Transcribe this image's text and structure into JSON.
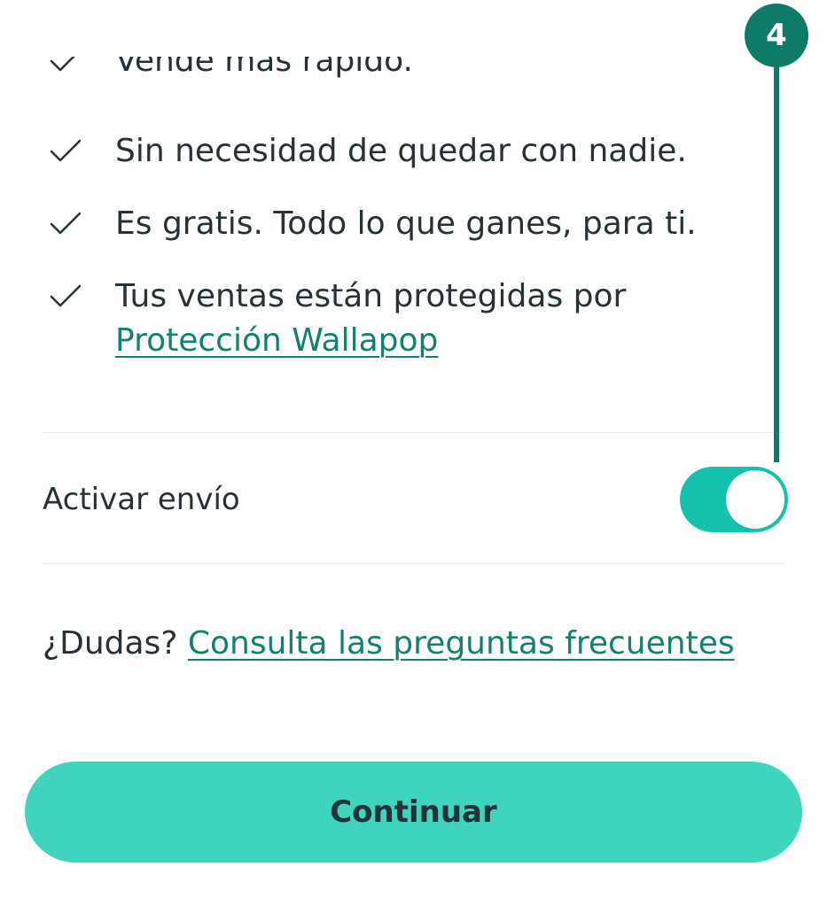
{
  "benefits": {
    "items": [
      {
        "text": "Vende más rápido."
      },
      {
        "text": "Sin necesidad de quedar con nadie."
      },
      {
        "text": "Es gratis. Todo lo que ganes, para ti."
      },
      {
        "text": "Tus ventas están protegidas por",
        "link": "Protección Wallapop"
      }
    ]
  },
  "shipping_toggle": {
    "label": "Activar envío",
    "on": true
  },
  "faq": {
    "prefix": "¿Dudas?",
    "link": "Consulta las preguntas frecuentes"
  },
  "cta": {
    "label": "Continuar"
  },
  "annotation": {
    "number": "4"
  },
  "colors": {
    "primary": "#13C1AC",
    "button": "#3ED4BD",
    "link": "#13816F",
    "annotation": "#0E7A68",
    "text": "#253238"
  },
  "icons": {
    "benefit": "check-icon"
  }
}
